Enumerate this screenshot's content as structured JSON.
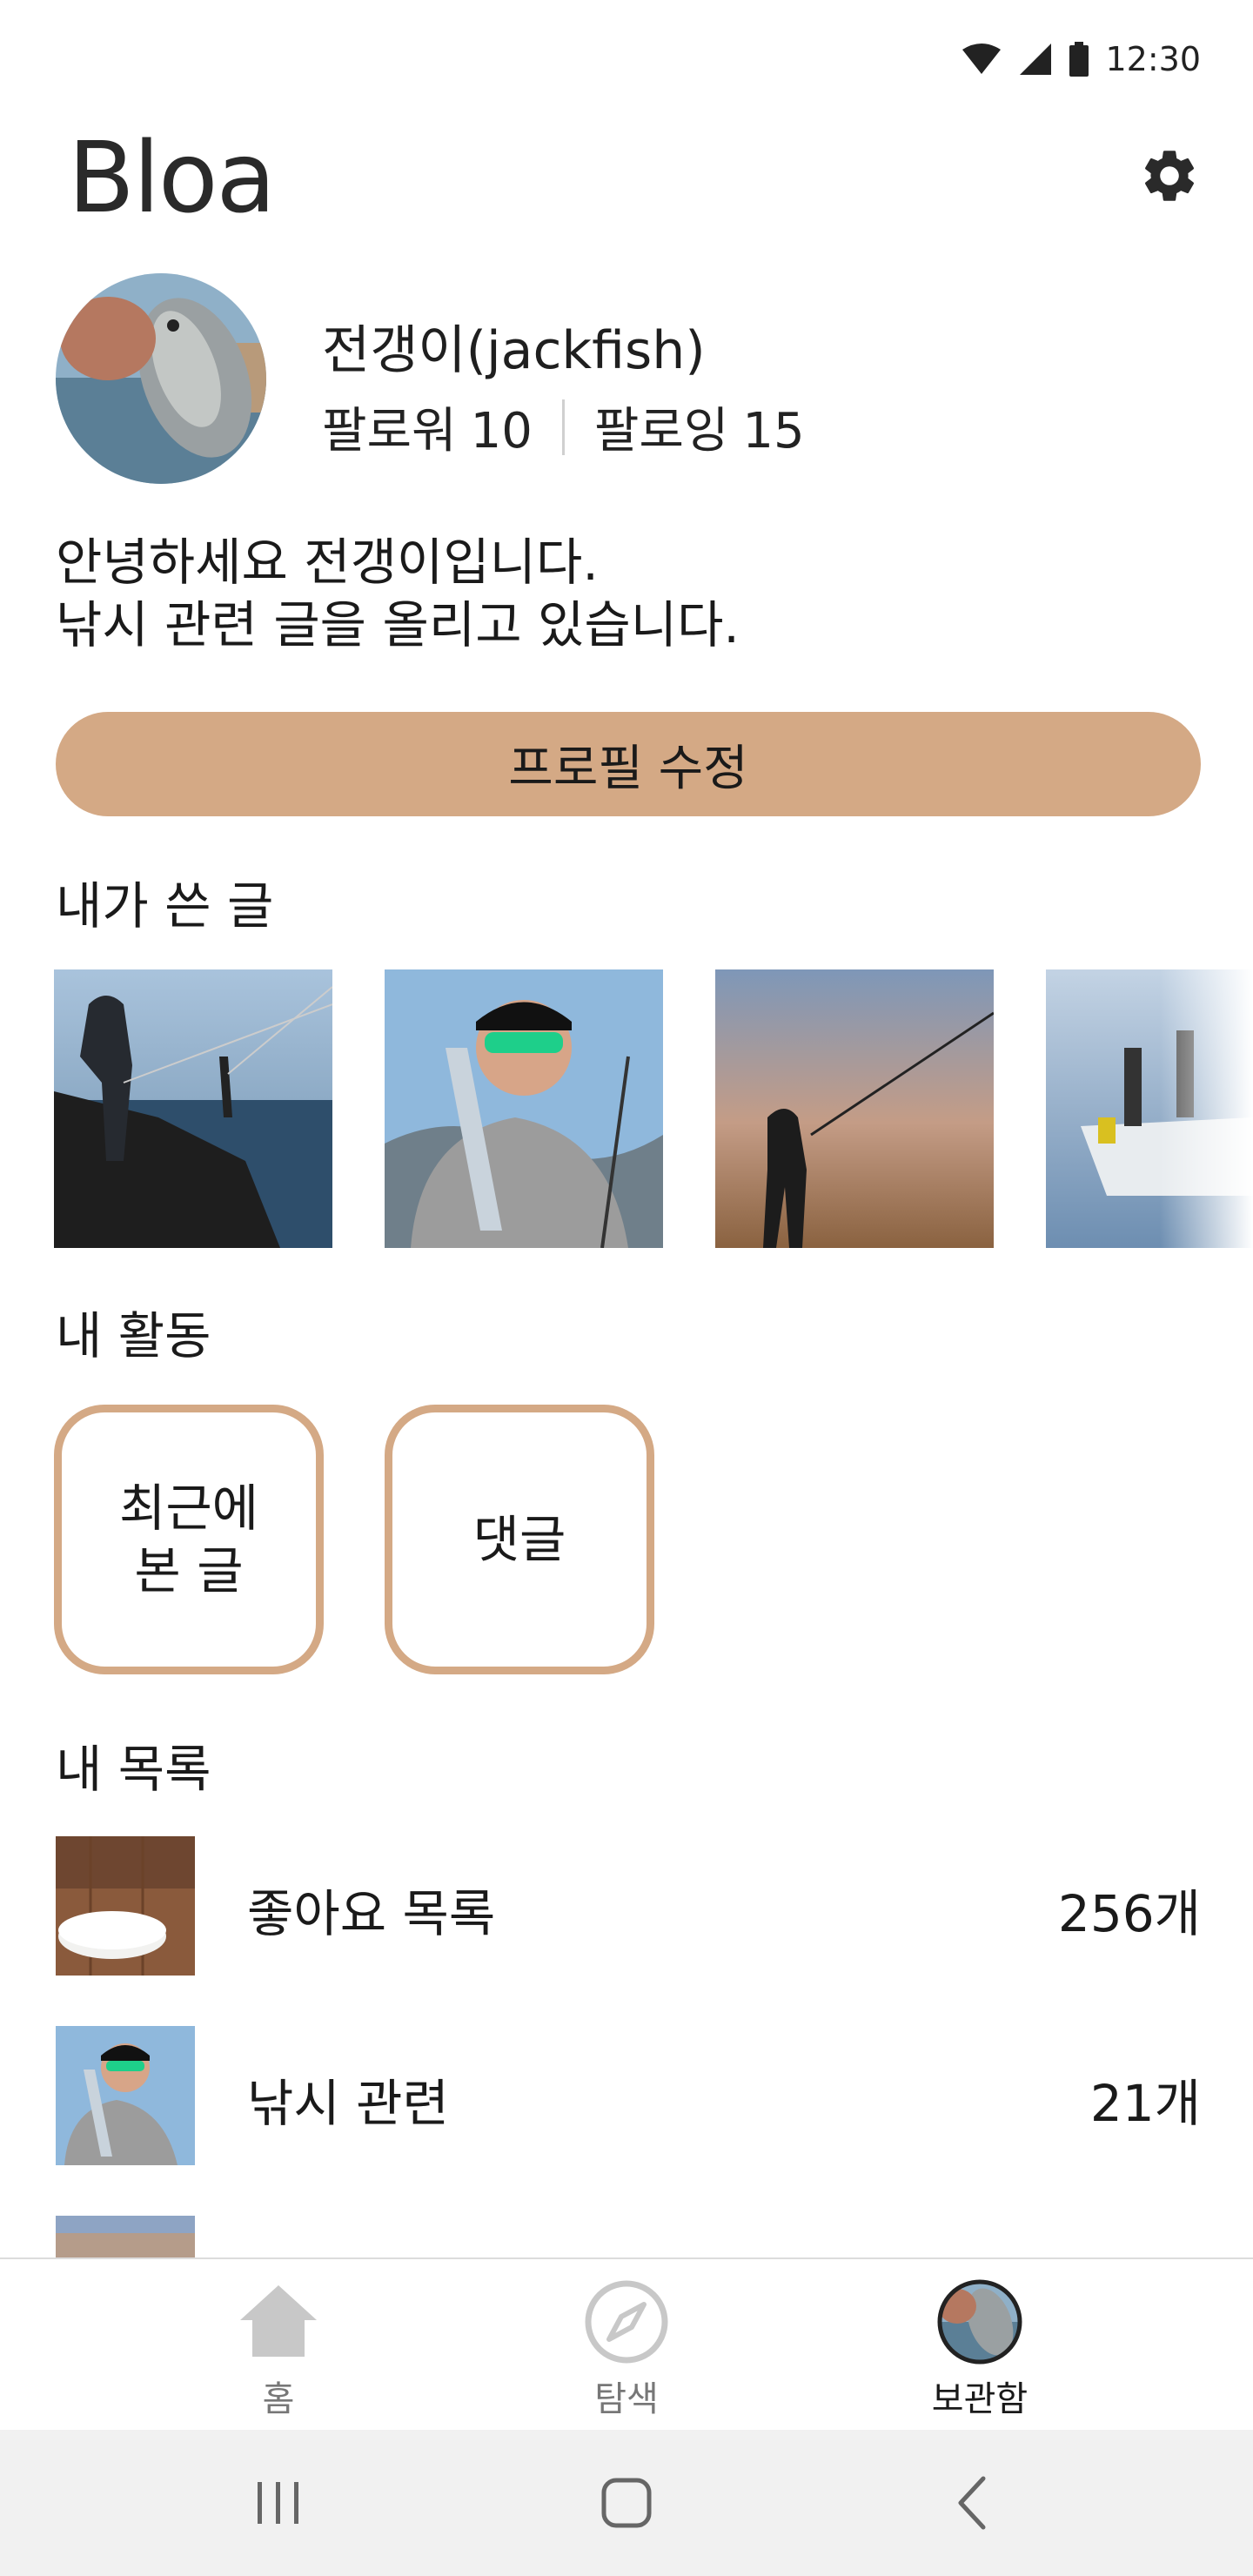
{
  "status_bar": {
    "time": "12:30",
    "icons": [
      "wifi-icon",
      "signal-icon",
      "battery-icon"
    ]
  },
  "header": {
    "title": "Bloa",
    "settings_icon": "gear-icon"
  },
  "profile": {
    "name": "전갱이(jackfish)",
    "followers_label": "팔로워",
    "followers_count": "10",
    "following_label": "팔로잉",
    "following_count": "15",
    "bio_line1": "안녕하세요 전갱이입니다.",
    "bio_line2": "낚시 관련 글을 올리고 있습니다.",
    "edit_button": "프로필 수정"
  },
  "posts": {
    "title": "내가 쓴 글",
    "items": [
      "rock-angler-photo",
      "angler-with-fish-photo",
      "sunset-angler-photo",
      "boat-fishing-photo"
    ]
  },
  "activity": {
    "title": "내 활동",
    "buttons": [
      "최근에\n본 글",
      "댓글"
    ]
  },
  "lists": {
    "title": "내 목록",
    "items": [
      {
        "label": "좋아요 목록",
        "count": "256개"
      },
      {
        "label": "낚시 관련",
        "count": "21개"
      }
    ]
  },
  "bottom_nav": {
    "items": [
      {
        "label": "홈",
        "icon": "home-icon"
      },
      {
        "label": "탐색",
        "icon": "compass-icon"
      },
      {
        "label": "보관함",
        "icon": "avatar-icon"
      }
    ],
    "active_index": 2
  },
  "system_nav": [
    "recents-icon",
    "home-button-icon",
    "back-icon"
  ],
  "colors": {
    "accent": "#d4a985",
    "nav_inactive": "#c8c8c8",
    "background": "#ffffff"
  }
}
